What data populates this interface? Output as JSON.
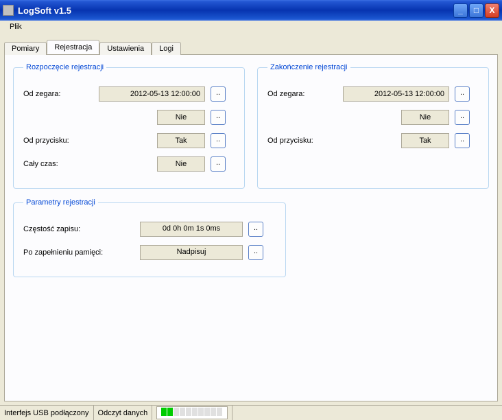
{
  "window": {
    "title": "LogSoft v1.5",
    "minimize": "_",
    "maximize": "□",
    "close": "X"
  },
  "menu": {
    "plik": "Plik"
  },
  "tabs": {
    "pomiary": "Pomiary",
    "rejestracja": "Rejestracja",
    "ustawienia": "Ustawienia",
    "logi": "Logi"
  },
  "groups": {
    "start": {
      "legend": "Rozpoczęcie rejestracji",
      "od_zegara_label": "Od zegara:",
      "od_zegara_value": "2012-05-13 12:00:00",
      "od_zegara_toggle": "Nie",
      "od_przycisku_label": "Od przycisku:",
      "od_przycisku_value": "Tak",
      "caly_czas_label": "Cały czas:",
      "caly_czas_value": "Nie"
    },
    "end": {
      "legend": "Zakończenie rejestracji",
      "od_zegara_label": "Od zegara:",
      "od_zegara_value": "2012-05-13 12:00:00",
      "od_zegara_toggle": "Nie",
      "od_przycisku_label": "Od przycisku:",
      "od_przycisku_value": "Tak"
    },
    "params": {
      "legend": "Parametry rejestracji",
      "freq_label": "Częstość zapisu:",
      "freq_value": "0d 0h 0m 1s 0ms",
      "mem_label": "Po zapełnieniu pamięci:",
      "mem_value": "Nadpisuj"
    }
  },
  "ellipsis": "..",
  "status": {
    "usb": "Interfejs USB podłączony",
    "read": "Odczyt danych"
  }
}
